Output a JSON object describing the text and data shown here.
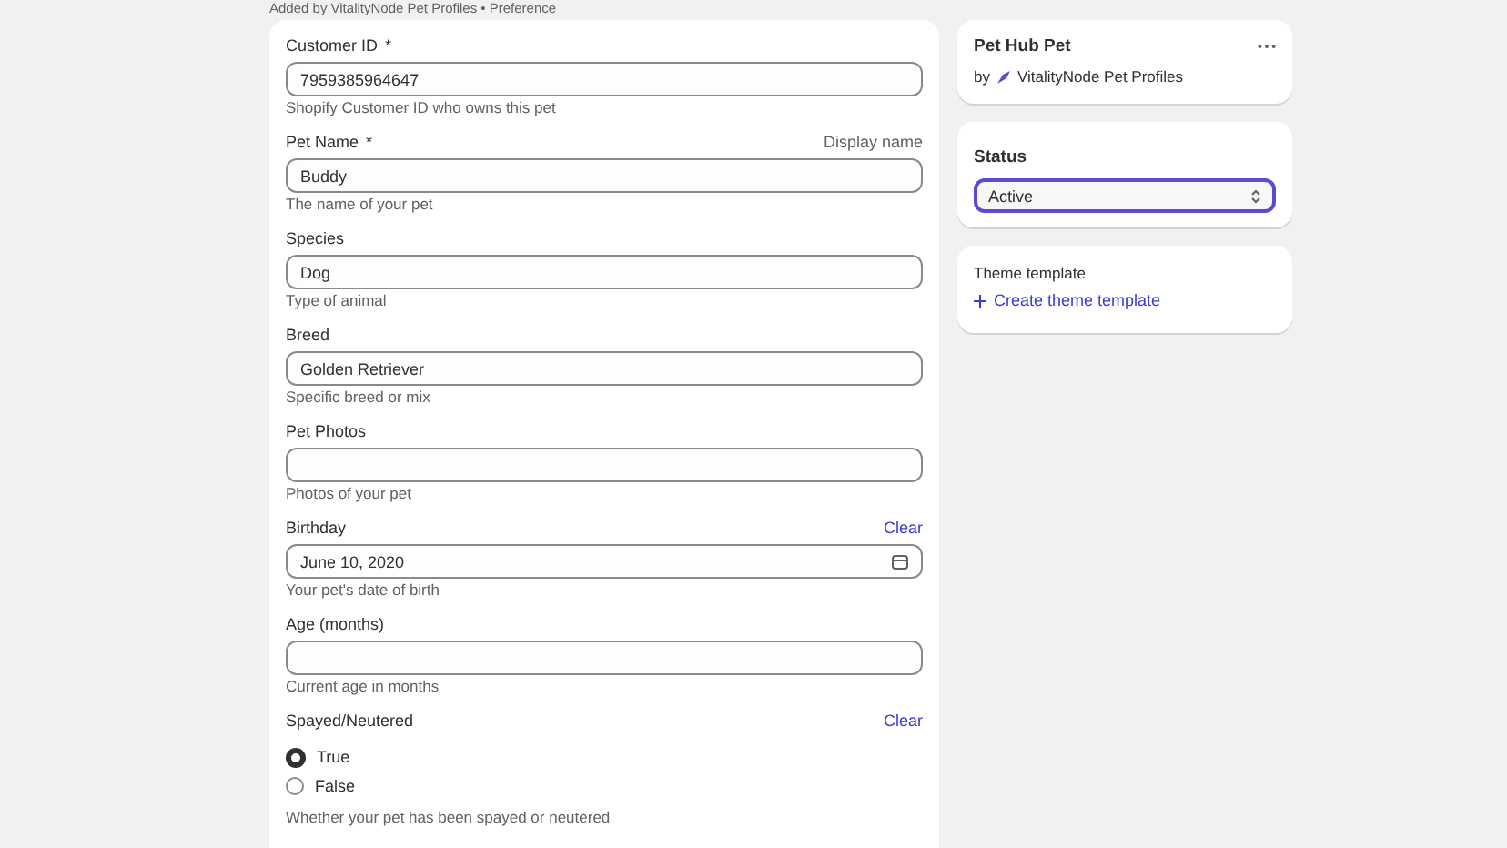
{
  "breadcrumb": "Added by VitalityNode Pet Profiles • Preference",
  "fields": [
    {
      "kind": "text",
      "label": "Customer ID",
      "marker": "*",
      "value": "7959385964647",
      "help": "Shopify Customer ID who owns this pet"
    },
    {
      "kind": "text",
      "label": "Pet Name",
      "marker": "*",
      "aside": "Display name",
      "value": "Buddy",
      "help": "The name of your pet"
    },
    {
      "kind": "text",
      "label": "Species",
      "value": "Dog",
      "help": "Type of animal"
    },
    {
      "kind": "text",
      "label": "Breed",
      "value": "Golden Retriever",
      "help": "Specific breed or mix"
    },
    {
      "kind": "text",
      "label": "Pet Photos",
      "help": "Photos of your pet"
    },
    {
      "kind": "date",
      "label": "Birthday",
      "clear": "Clear",
      "value": "June 10, 2020",
      "help": "Your pet's date of birth"
    },
    {
      "kind": "text",
      "label": "Age (months)",
      "help": "Current age in months"
    },
    {
      "kind": "radio",
      "label": "Spayed/Neutered",
      "clear": "Clear",
      "options": [
        {
          "label": "True",
          "selected": true
        },
        {
          "label": "False",
          "selected": false
        }
      ],
      "help": "Whether your pet has been spayed or neutered"
    }
  ],
  "app_card": {
    "title": "Pet Hub Pet",
    "by": "by",
    "app": "VitalityNode Pet Profiles"
  },
  "status": {
    "title": "Status",
    "value": "Active"
  },
  "theme": {
    "title": "Theme template",
    "link": "Create theme template"
  }
}
